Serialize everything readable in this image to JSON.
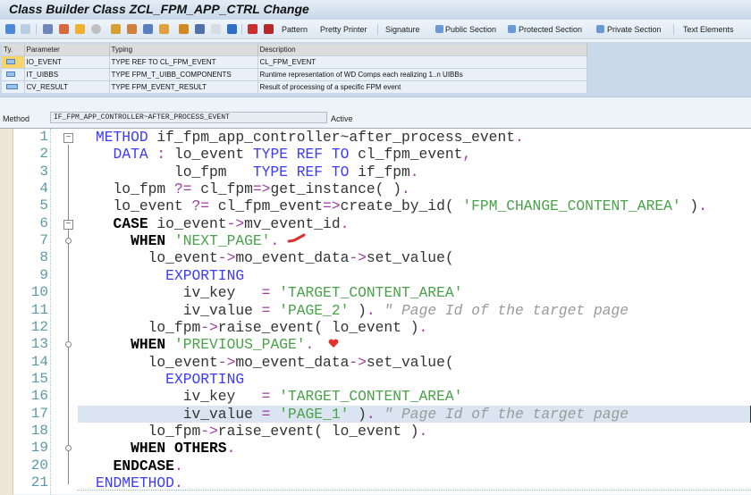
{
  "window": {
    "title": "Class Builder Class ZCL_FPM_APP_CTRL Change"
  },
  "toolbar": {
    "pattern": "Pattern",
    "pretty_printer": "Pretty Printer",
    "signature": "Signature",
    "public_section": "Public Section",
    "protected_section": "Protected Section",
    "private_section": "Private Section",
    "text_elements": "Text Elements"
  },
  "params": {
    "headers": [
      "Ty.",
      "Parameter",
      "Typing",
      "Description"
    ],
    "rows": [
      {
        "parameter": "IO_EVENT",
        "typing": "TYPE REF TO CL_FPM_EVENT",
        "description": "CL_FPM_EVENT",
        "selected": true
      },
      {
        "parameter": "IT_UIBBS",
        "typing": "TYPE FPM_T_UIBB_COMPONENTS",
        "description": "Runtime representation of WD Comps each realizing 1..n UIBBs"
      },
      {
        "parameter": "CV_RESULT",
        "typing": "TYPE FPM_EVENT_RESULT",
        "description": "Result of processing of a specific FPM event"
      }
    ]
  },
  "method": {
    "label": "Method",
    "value": "IF_FPM_APP_CONTROLLER~AFTER_PROCESS_EVENT",
    "status": "Active"
  },
  "editor": {
    "highlighted_line": 17,
    "lines": [
      [
        [
          "kw",
          "METHOD"
        ],
        [
          "id",
          " if_fpm_app_controller~after_process_event"
        ],
        [
          "op",
          "."
        ]
      ],
      [
        [
          "id",
          "  "
        ],
        [
          "kw",
          "DATA"
        ],
        [
          "op",
          " :"
        ],
        [
          "id",
          " lo_event "
        ],
        [
          "kw",
          "TYPE REF TO"
        ],
        [
          "id",
          " cl_fpm_event"
        ],
        [
          "op",
          ","
        ]
      ],
      [
        [
          "id",
          "         lo_fpm   "
        ],
        [
          "kw",
          "TYPE REF TO"
        ],
        [
          "id",
          " if_fpm"
        ],
        [
          "op",
          "."
        ]
      ],
      [
        [
          "id",
          "  lo_fpm "
        ],
        [
          "op",
          "?="
        ],
        [
          "id",
          " cl_fpm"
        ],
        [
          "op",
          "=>"
        ],
        [
          "id",
          "get_instance( )"
        ],
        [
          "op",
          "."
        ]
      ],
      [
        [
          "id",
          "  lo_event "
        ],
        [
          "op",
          "?="
        ],
        [
          "id",
          " cl_fpm_event"
        ],
        [
          "op",
          "=>"
        ],
        [
          "id",
          "create_by_id( "
        ],
        [
          "str",
          "'FPM_CHANGE_CONTENT_AREA'"
        ],
        [
          "id",
          " )"
        ],
        [
          "op",
          "."
        ]
      ],
      [
        [
          "id",
          "  "
        ],
        [
          "bk",
          "CASE"
        ],
        [
          "id",
          " io_event"
        ],
        [
          "op",
          "->"
        ],
        [
          "id",
          "mv_event_id"
        ],
        [
          "op",
          "."
        ]
      ],
      [
        [
          "id",
          "    "
        ],
        [
          "bk",
          "WHEN"
        ],
        [
          "id",
          " "
        ],
        [
          "str",
          "'NEXT_PAGE'"
        ],
        [
          "op",
          "."
        ]
      ],
      [
        [
          "id",
          "      lo_event"
        ],
        [
          "op",
          "->"
        ],
        [
          "id",
          "mo_event_data"
        ],
        [
          "op",
          "->"
        ],
        [
          "id",
          "set_value("
        ]
      ],
      [
        [
          "id",
          "        "
        ],
        [
          "kw",
          "EXPORTING"
        ]
      ],
      [
        [
          "id",
          "          iv_key   "
        ],
        [
          "op",
          "="
        ],
        [
          "id",
          " "
        ],
        [
          "str",
          "'TARGET_CONTENT_AREA'"
        ]
      ],
      [
        [
          "id",
          "          iv_value "
        ],
        [
          "op",
          "="
        ],
        [
          "id",
          " "
        ],
        [
          "str",
          "'PAGE_2'"
        ],
        [
          "id",
          " )"
        ],
        [
          "op",
          "."
        ],
        [
          "id",
          " "
        ],
        [
          "cm",
          "\" Page Id of the target page"
        ]
      ],
      [
        [
          "id",
          "      lo_fpm"
        ],
        [
          "op",
          "->"
        ],
        [
          "id",
          "raise_event( lo_event )"
        ],
        [
          "op",
          "."
        ]
      ],
      [
        [
          "id",
          "    "
        ],
        [
          "bk",
          "WHEN"
        ],
        [
          "id",
          " "
        ],
        [
          "str",
          "'PREVIOUS_PAGE'"
        ],
        [
          "op",
          "."
        ]
      ],
      [
        [
          "id",
          "      lo_event"
        ],
        [
          "op",
          "->"
        ],
        [
          "id",
          "mo_event_data"
        ],
        [
          "op",
          "->"
        ],
        [
          "id",
          "set_value("
        ]
      ],
      [
        [
          "id",
          "        "
        ],
        [
          "kw",
          "EXPORTING"
        ]
      ],
      [
        [
          "id",
          "          iv_key   "
        ],
        [
          "op",
          "="
        ],
        [
          "id",
          " "
        ],
        [
          "str",
          "'TARGET_CONTENT_AREA'"
        ]
      ],
      [
        [
          "id",
          "          iv_value "
        ],
        [
          "op",
          "="
        ],
        [
          "id",
          " "
        ],
        [
          "str",
          "'PAGE_1'"
        ],
        [
          "id",
          " )"
        ],
        [
          "op",
          "."
        ],
        [
          "id",
          " "
        ],
        [
          "cm",
          "\" Page Id of the target page"
        ]
      ],
      [
        [
          "id",
          "      lo_fpm"
        ],
        [
          "op",
          "->"
        ],
        [
          "id",
          "raise_event( lo_event )"
        ],
        [
          "op",
          "."
        ]
      ],
      [
        [
          "id",
          "    "
        ],
        [
          "bk",
          "WHEN OTHERS"
        ],
        [
          "op",
          "."
        ]
      ],
      [
        [
          "id",
          "  "
        ],
        [
          "bk",
          "ENDCASE"
        ],
        [
          "op",
          "."
        ]
      ],
      [
        [
          "kw",
          "ENDMETHOD"
        ],
        [
          "op",
          "."
        ]
      ]
    ]
  }
}
